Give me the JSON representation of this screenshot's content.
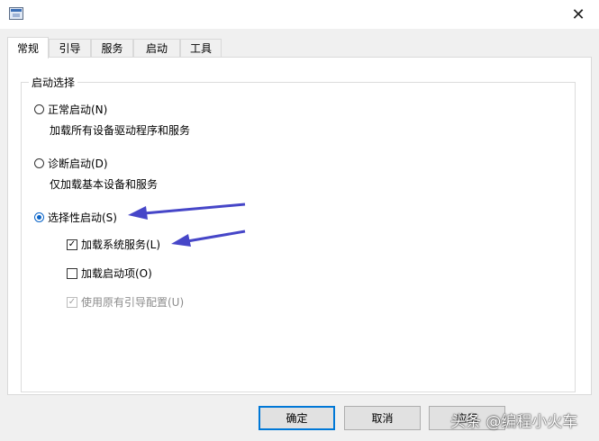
{
  "window": {
    "close_glyph": "✕"
  },
  "tabs": [
    {
      "label": "常规",
      "active": true
    },
    {
      "label": "引导"
    },
    {
      "label": "服务"
    },
    {
      "label": "启动"
    },
    {
      "label": "工具"
    }
  ],
  "startup": {
    "group_label": "启动选择",
    "normal": {
      "label": "正常启动(N)",
      "desc": "加载所有设备驱动程序和服务"
    },
    "diagnostic": {
      "label": "诊断启动(D)",
      "desc": "仅加载基本设备和服务"
    },
    "selective": {
      "label": "选择性启动(S)",
      "load_services": "加载系统服务(L)",
      "load_startup": "加载启动项(O)",
      "use_original": "使用原有引导配置(U)"
    }
  },
  "buttons": {
    "ok": "确定",
    "cancel": "取消",
    "apply": "应用"
  },
  "watermark": "头条 @编程小火车",
  "colors": {
    "arrow": "#4646c8",
    "accent": "#0078d7"
  }
}
